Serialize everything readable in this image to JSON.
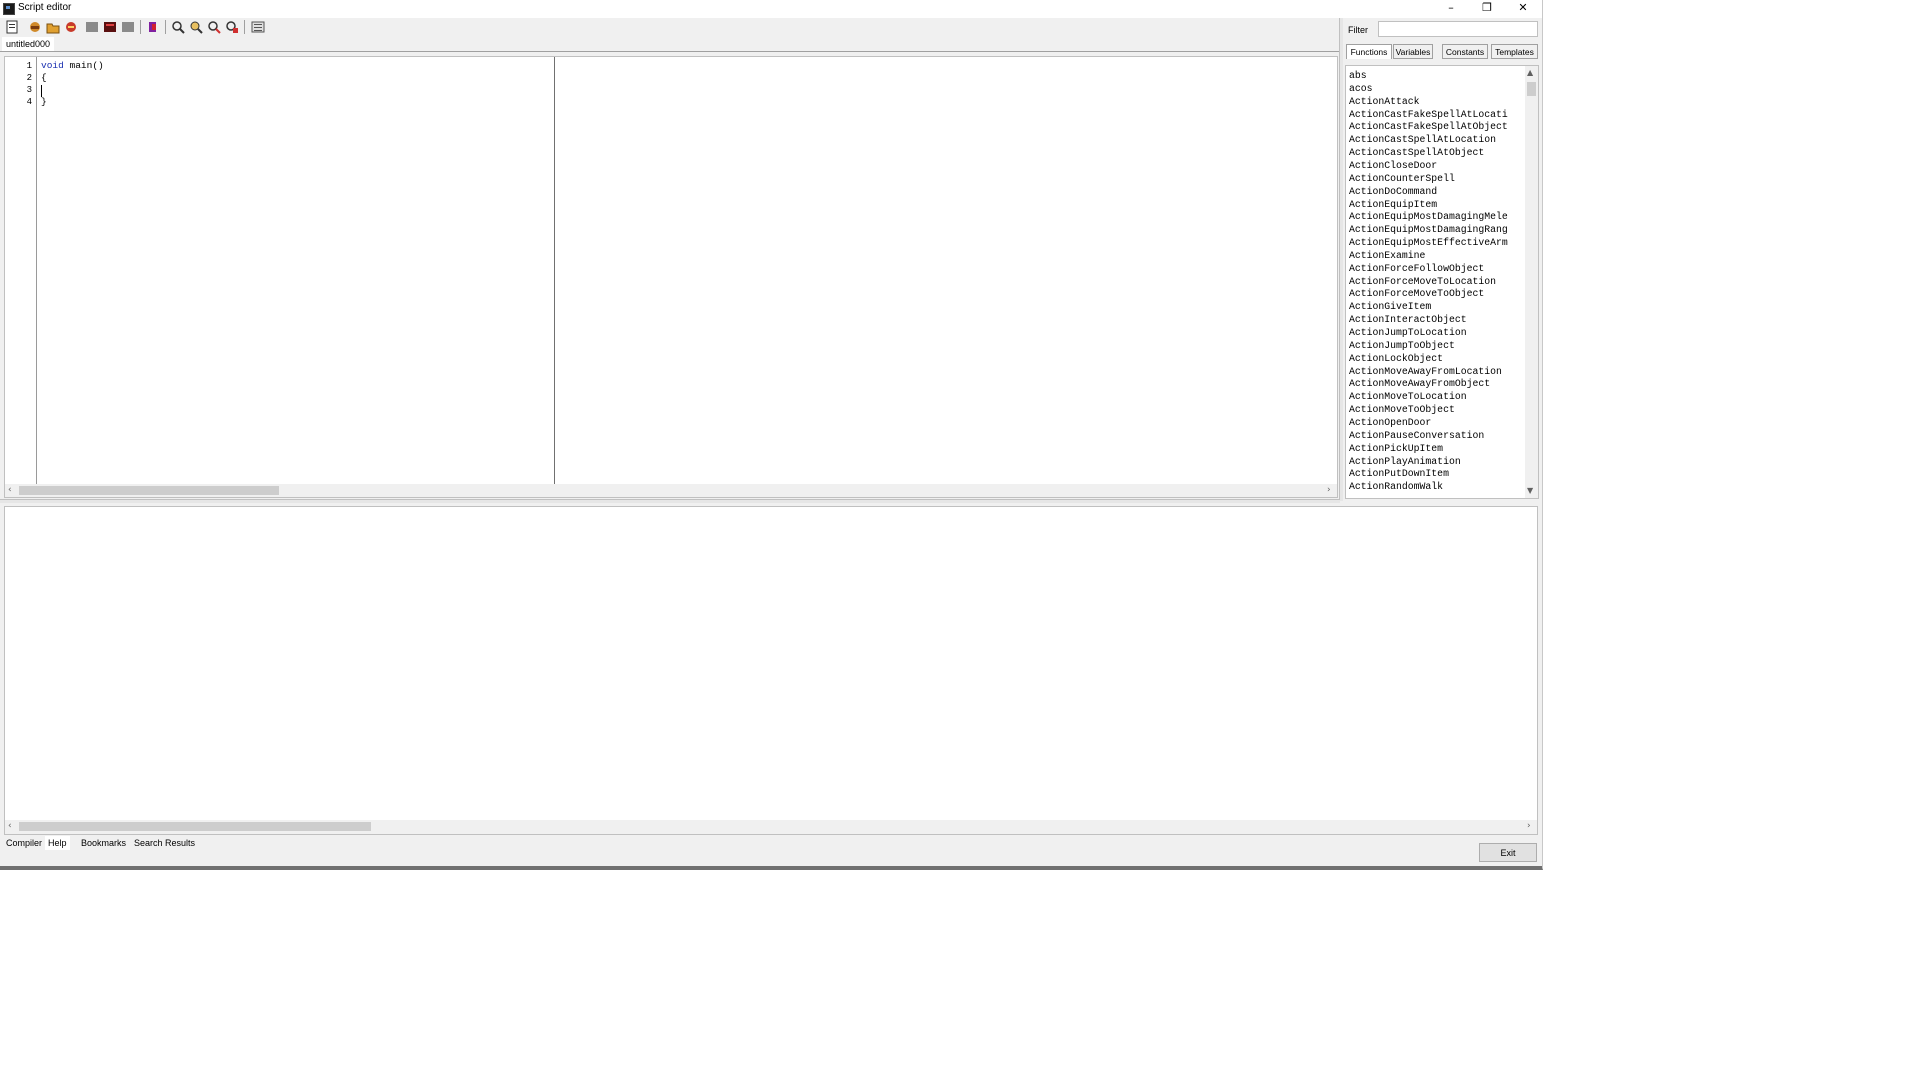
{
  "window": {
    "title": "Script editor",
    "controls": {
      "minimize": "–",
      "maximize": "❐",
      "close": "✕"
    }
  },
  "toolbar": {
    "buttons": [
      "new-icon",
      "open-icon",
      "open-folder-icon",
      "save-icon",
      "save-as-icon",
      "compile-icon",
      "save-all-icon",
      "book-icon",
      "find-icon",
      "find-next-icon",
      "replace-icon",
      "goto-icon",
      "options-icon"
    ]
  },
  "document_tab": {
    "label": "untitled000"
  },
  "editor": {
    "line_numbers": [
      "1",
      "2",
      "3",
      "4"
    ],
    "lines": [
      {
        "keyword": "void",
        "rest": " main()"
      },
      {
        "keyword": "",
        "rest": "{"
      },
      {
        "keyword": "",
        "rest": ""
      },
      {
        "keyword": "",
        "rest": "}"
      }
    ]
  },
  "right_panel": {
    "filter_label": "Filter",
    "filter_value": "",
    "tabs": [
      "Functions",
      "Variables",
      "Constants",
      "Templates"
    ],
    "active_tab": "Functions",
    "functions": [
      "abs",
      "acos",
      "ActionAttack",
      "ActionCastFakeSpellAtLocati",
      "ActionCastFakeSpellAtObject",
      "ActionCastSpellAtLocation",
      "ActionCastSpellAtObject",
      "ActionCloseDoor",
      "ActionCounterSpell",
      "ActionDoCommand",
      "ActionEquipItem",
      "ActionEquipMostDamagingMele",
      "ActionEquipMostDamagingRang",
      "ActionEquipMostEffectiveArm",
      "ActionExamine",
      "ActionForceFollowObject",
      "ActionForceMoveToLocation",
      "ActionForceMoveToObject",
      "ActionGiveItem",
      "ActionInteractObject",
      "ActionJumpToLocation",
      "ActionJumpToObject",
      "ActionLockObject",
      "ActionMoveAwayFromLocation",
      "ActionMoveAwayFromObject",
      "ActionMoveToLocation",
      "ActionMoveToObject",
      "ActionOpenDoor",
      "ActionPauseConversation",
      "ActionPickUpItem",
      "ActionPlayAnimation",
      "ActionPutDownItem",
      "ActionRandomWalk"
    ]
  },
  "bottom_tabs": [
    "Compiler",
    "Help",
    "Bookmarks",
    "Search Results"
  ],
  "active_bottom_tab": "Help",
  "exit_label": "Exit",
  "colors": {
    "keyword": "#1a2fb0",
    "background": "#f0f0f0"
  }
}
